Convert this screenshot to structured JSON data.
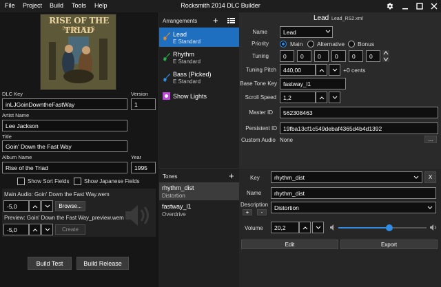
{
  "app": {
    "title": "Rocksmith 2014 DLC Builder",
    "menu": [
      "File",
      "Project",
      "Build",
      "Tools",
      "Help"
    ]
  },
  "metadata": {
    "album_art_title": "RISE OF THE TRIAD",
    "album_art_subtitle": "DARK WAR",
    "dlc_key_label": "DLC Key",
    "dlc_key": "inLJGoinDowntheFastWay",
    "version_label": "Version",
    "version": "1",
    "artist_label": "Artist Name",
    "artist": "Lee Jackson",
    "title_label": "Title",
    "title": "Goin' Down the Fast Way",
    "album_label": "Album Name",
    "album": "Rise of the Triad",
    "year_label": "Year",
    "year": "1995",
    "show_sort_fields": "Show Sort Fields",
    "show_japanese_fields": "Show Japanese Fields"
  },
  "audio": {
    "main_label": "Main Audio: Goin' Down the Fast Way.wem",
    "main_volume": "-5,0",
    "browse": "Browse...",
    "preview_label": "Preview: Goin' Down the Fast Way_preview.wem",
    "preview_volume": "-5,0",
    "create": "Create"
  },
  "build": {
    "test": "Build Test",
    "release": "Build Release"
  },
  "arrangements": {
    "header": "Arrangements",
    "items": [
      {
        "name": "Lead",
        "tuning": "E Standard"
      },
      {
        "name": "Rhythm",
        "tuning": "E Standard"
      },
      {
        "name": "Bass (Picked)",
        "tuning": "E Standard"
      },
      {
        "name": "Show Lights",
        "tuning": ""
      }
    ]
  },
  "arrangement": {
    "heading": "Lead",
    "file": "Lead_RS2.xml",
    "name_label": "Name",
    "name": "Lead",
    "priority_label": "Priority",
    "priority_options": [
      "Main",
      "Alternative",
      "Bonus"
    ],
    "tuning_label": "Tuning",
    "tuning": [
      "0",
      "0",
      "0",
      "0",
      "0",
      "0"
    ],
    "pitch_label": "Tuning Pitch",
    "pitch": "440,00",
    "pitch_cents": "+0 cents",
    "base_tone_label": "Base Tone Key",
    "base_tone": "fastway_l1",
    "scroll_label": "Scroll Speed",
    "scroll": "1,2",
    "master_id_label": "Master ID",
    "master_id": "562308463",
    "persistent_id_label": "Persistent ID",
    "persistent_id": "19fba13cf1c549debaf4365d4b4d1392",
    "custom_audio_label": "Custom Audio",
    "custom_audio": "None",
    "custom_audio_btn": "..."
  },
  "tones": {
    "header": "Tones",
    "items": [
      {
        "name": "rhythm_dist",
        "desc": "Distortion"
      },
      {
        "name": "fastway_l1",
        "desc": "Overdrive"
      }
    ]
  },
  "tone": {
    "key_label": "Key",
    "key": "rhythm_dist",
    "clear": "X",
    "name_label": "Name",
    "name": "rhythm_dist",
    "desc_label": "Description",
    "desc": "Distortion",
    "desc_add": "+",
    "desc_remove": "-",
    "volume_label": "Volume",
    "volume": "20,2",
    "volume_level": 0.58,
    "edit": "Edit",
    "export": "Export"
  },
  "colors": {
    "accent": "#2f8de4",
    "selected": "#1f6fc0",
    "lead_icon": "#e08a2a",
    "rhythm_icon": "#27b34a",
    "bass_icon": "#2f8de4",
    "lights_icon": "#c04ad8"
  }
}
